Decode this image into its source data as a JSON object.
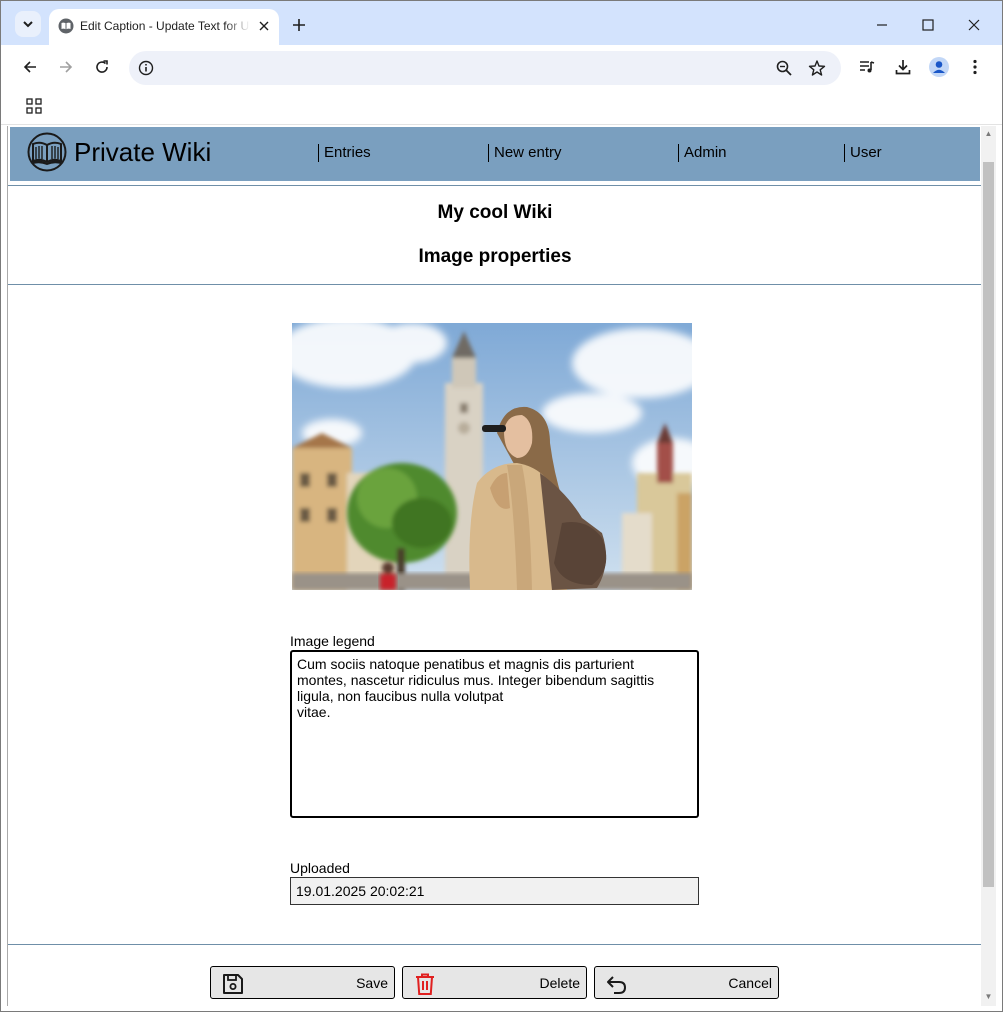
{
  "browser": {
    "tab_title": "Edit Caption - Update Text for U",
    "address": ""
  },
  "site": {
    "title": "Private Wiki",
    "nav": [
      "Entries",
      "New entry",
      "Admin",
      "User"
    ]
  },
  "page": {
    "wiki_name": "My cool Wiki",
    "heading": "Image properties"
  },
  "form": {
    "legend_label": "Image legend",
    "legend_text": "Cum sociis natoque penatibus et magnis dis parturient\nmontes, nascetur ridiculus mus. Integer bibendum sagittis\nligula, non faucibus nulla volutpat\nvitae.",
    "uploaded_label": "Uploaded",
    "uploaded_value": "19.01.2025 20:02:21"
  },
  "buttons": {
    "save": "Save",
    "delete": "Delete",
    "cancel": "Cancel"
  },
  "colors": {
    "header_bg": "#7a9fbf",
    "tabstrip_bg": "#d3e3fd",
    "delete_icon": "#e02020"
  },
  "icons": {
    "logo": "open-book-icon",
    "save": "floppy-disk-icon",
    "delete": "trash-icon",
    "cancel": "undo-arrow-icon"
  }
}
